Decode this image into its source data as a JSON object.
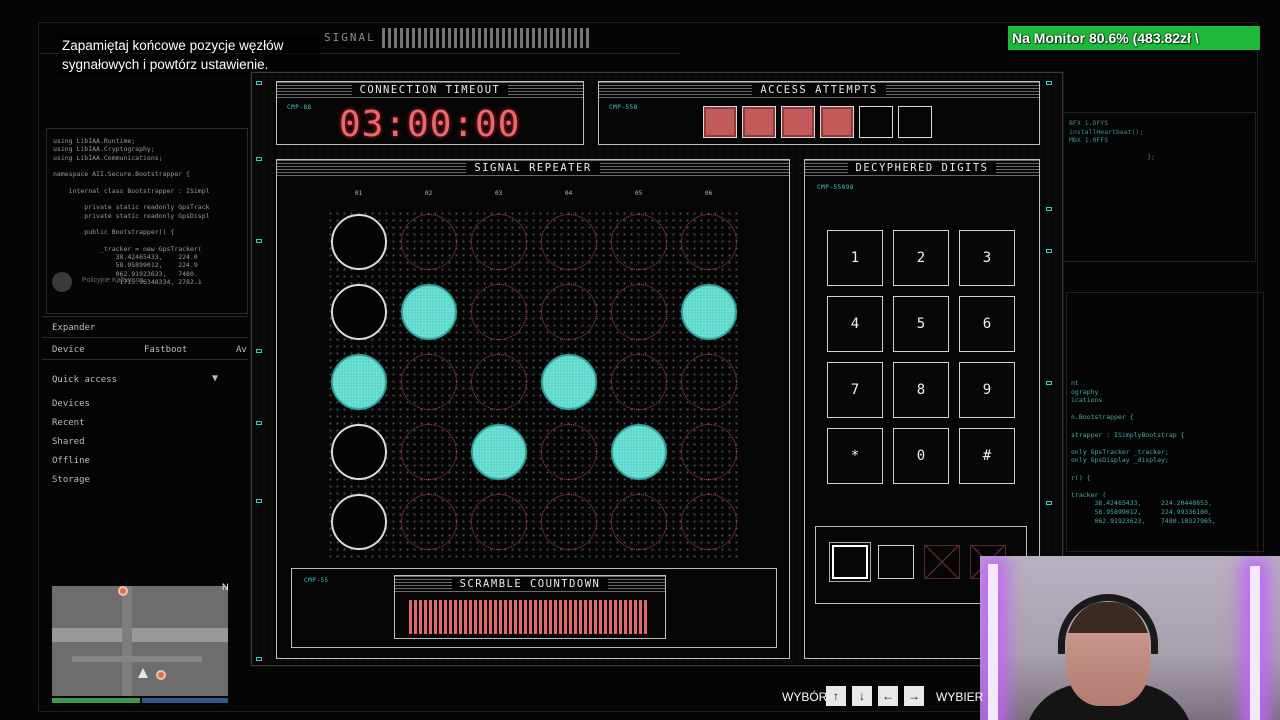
{
  "instruction": "Zapamiętaj końcowe pozycje węzłów sygnałowych i powtórz ustawienie.",
  "top_strip": {
    "signal_label": "SIGNAL"
  },
  "monitor_badge": "Na Monitor 80.6% (483.82zł \\",
  "code_left": "using LibIAA.Runtime;\nusing LibIAA.Cryptography;\nusing LibIAA.Communications;\n\nnamespace AII.Secure.Bootstrapper {\n\n    internal class Bootstrapper : ISimpl\n\n        private static readonly GpsTrack\n        private static readonly GpsDispl\n\n        public Bootstrapper() {\n\n            _tracker = new GpsTracker(\n                38.42465433,    224.0\n                58.95899012,    224.9\n                062.91923623,   7480.\n                -1715.96348334, 2782.1",
  "code_right": "BFX 1.DFYS\ninstallHeartbeat();\nMBX 1.0FFS\n\n                    };",
  "code_right2": "nt\nography\nications\n\nn.Bootstrapper {\n\nstrapper : ISimplyBootstrap {\n\nonly GpsTracker _tracker;\nonly GpsDisplay _display;\n\nr() {\n\ntracker (\n      38.42465433,     224.20448653,\n      58.95899012,     224.99336180,\n      062.91923623,    7480.10327965,",
  "side_panel": {
    "expander": "Expander",
    "device": "Device",
    "fastboot": "Fastboot",
    "av": "Av",
    "quick_access": "Quick access",
    "items": [
      "Devices",
      "Recent",
      "Shared",
      "Offline",
      "Storage"
    ],
    "discord_label": "Policyjne Kalbarson"
  },
  "minimap": {
    "north": "N"
  },
  "connection_timeout": {
    "title": "CONNECTION TIMEOUT",
    "tag": "CMP-88",
    "value": "03:00:00"
  },
  "access_attempts": {
    "title": "ACCESS ATTEMPTS",
    "tag": "CMP-558",
    "total": 6,
    "used": 4
  },
  "signal_repeater": {
    "title": "SIGNAL REPEATER",
    "columns": [
      "01",
      "02",
      "03",
      "04",
      "05",
      "06"
    ],
    "rows": [
      [
        "white",
        "red",
        "red",
        "red",
        "red",
        "red"
      ],
      [
        "white",
        "filled",
        "red",
        "red",
        "red",
        "filled"
      ],
      [
        "filled",
        "red",
        "red",
        "filled",
        "red",
        "red"
      ],
      [
        "white",
        "red",
        "filled",
        "red",
        "filled",
        "red"
      ],
      [
        "white",
        "red",
        "red",
        "red",
        "red",
        "red"
      ]
    ]
  },
  "decyphered_digits": {
    "title": "DECYPHERED DIGITS",
    "tag": "CMP-55898",
    "keys": [
      "1",
      "2",
      "3",
      "4",
      "5",
      "6",
      "7",
      "8",
      "9",
      "*",
      "0",
      "#"
    ],
    "slots": [
      "active",
      "empty",
      "dim",
      "dim"
    ]
  },
  "scramble_countdown": {
    "title": "SCRAMBLE COUNTDOWN",
    "tag": "CMP-55",
    "progress": 1.0
  },
  "controls": {
    "select_label": "WYBÓR",
    "keys": [
      "↑",
      "↓",
      "←",
      "→"
    ],
    "choose_label": "WYBIER"
  },
  "colors": {
    "accent": "#58d8cc",
    "alert": "#e86a6a",
    "monitor": "#1eb83a"
  }
}
